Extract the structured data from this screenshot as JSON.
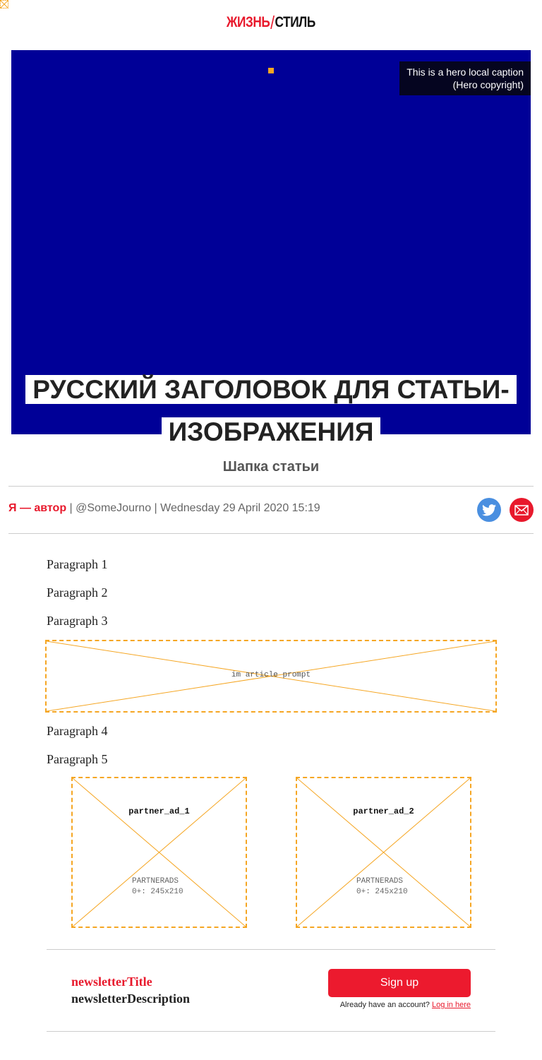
{
  "logo": {
    "part1": "ЖИЗНЬ",
    "slash": "/",
    "part2": "СТИЛЬ"
  },
  "hero": {
    "background_color": "#000097",
    "caption_line1": "This is a hero local caption",
    "caption_line2": "(Hero copyright)"
  },
  "headline": "РУССКИЙ ЗАГОЛОВОК ДЛЯ СТАТЬИ-ИЗОБРАЖЕНИЯ",
  "subheadline": "Шапка статьи",
  "byline": {
    "author": "Я — автор",
    "separator": " | ",
    "handle": "@SomeJourno",
    "date": "Wednesday 29 April 2020 15:19"
  },
  "share": {
    "twitter_icon": "twitter-icon",
    "email_icon": "email-icon"
  },
  "paragraphs": [
    "Paragraph 1",
    "Paragraph 2",
    "Paragraph 3",
    "Paragraph 4",
    "Paragraph 5"
  ],
  "article_prompt": {
    "label": "im article prompt"
  },
  "ads": [
    {
      "title": "partner_ad_1",
      "line1": "PARTNERADS",
      "line2": "0+: 245x210"
    },
    {
      "title": "partner_ad_2",
      "line1": "PARTNERADS",
      "line2": "0+: 245x210"
    }
  ],
  "newsletter": {
    "title": "newsletterTitle",
    "description": "newsletterDescription",
    "signup_label": "Sign up",
    "login_prompt": "Already have an account? ",
    "login_link": "Log in here"
  },
  "colors": {
    "accent": "#e8192c",
    "placeholder_border": "#f5a623",
    "twitter": "#4a8fe0"
  }
}
